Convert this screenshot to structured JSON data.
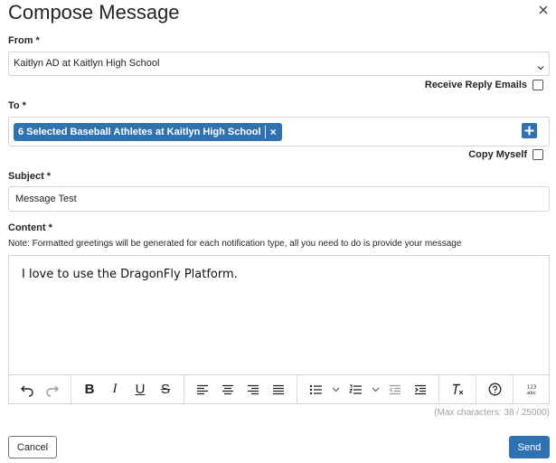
{
  "dialog": {
    "title": "Compose Message"
  },
  "from": {
    "label": "From *",
    "value": "Kaitlyn AD at Kaitlyn High School",
    "receive_reply_label": "Receive Reply Emails"
  },
  "to": {
    "label": "To *",
    "tag_text": "6 Selected Baseball Athletes at Kaitlyn High School",
    "tag_remove": "×",
    "copy_myself_label": "Copy Myself"
  },
  "subject": {
    "label": "Subject *",
    "value": "Message Test"
  },
  "content": {
    "label": "Content *",
    "note": "Note: Formatted greetings will be generated for each notification type, all you need to do is provide your message",
    "text": "I love to use the DragonFly Platform.",
    "counter": "(Max characters: 38 / 25000)"
  },
  "toolbar": {
    "bold": "B",
    "italic": "I",
    "underline": "U",
    "strike": "S"
  },
  "actions": {
    "cancel_label": "Cancel",
    "send_label": "Send"
  },
  "colors": {
    "accent": "#2f72b2",
    "border": "#ced4da",
    "muted": "#9aa0a6"
  }
}
